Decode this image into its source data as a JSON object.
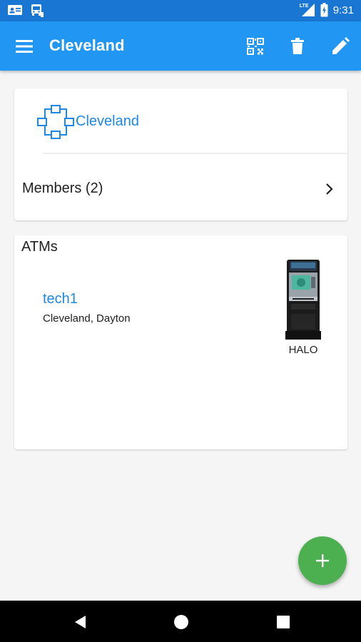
{
  "status_bar": {
    "time": "9:31",
    "network_label": "LTE",
    "icons": [
      "contact-card-icon",
      "bus-icon",
      "signal-icon",
      "battery-icon"
    ]
  },
  "app_bar": {
    "title": "Cleveland",
    "actions": [
      "qr-code-icon",
      "delete-icon",
      "edit-icon"
    ]
  },
  "group_card": {
    "name": "Cleveland",
    "icon": "group-network-icon",
    "members_label": "Members (2)"
  },
  "atms": {
    "section_title": "ATMs",
    "items": [
      {
        "name": "tech1",
        "location": "Cleveland, Dayton",
        "model": "HALO"
      }
    ]
  },
  "fab": {
    "icon": "plus-icon"
  },
  "nav_bar": {
    "icons": [
      "back-icon",
      "home-icon",
      "recents-icon"
    ]
  },
  "colors": {
    "primary": "#2196f3",
    "primary_dark": "#1976d2",
    "accent_text": "#1e88e5",
    "fab": "#4caf50"
  }
}
